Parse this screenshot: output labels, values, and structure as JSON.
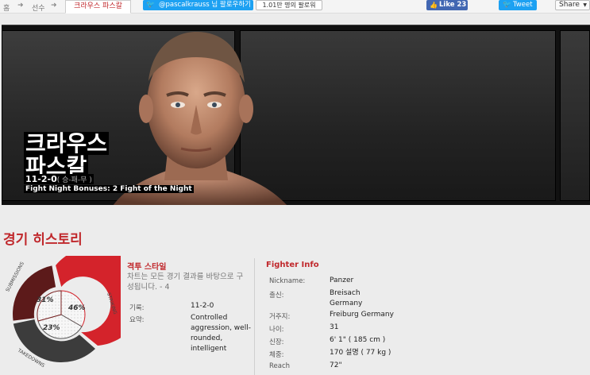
{
  "breadcrumb": {
    "home": "홈",
    "fighters": "선수",
    "current": "크라우스 파스칼"
  },
  "social": {
    "twitter_follow": "@pascalkrauss 님 팔로우하기",
    "follower_count": "1.01만 명의 팔로워",
    "fb_like": "Like",
    "fb_like_count": "23",
    "tweet": "Tweet",
    "share": "Share"
  },
  "hero": {
    "name_line1": "크라우스",
    "name_line2": "파스칼",
    "record": "11-2-0",
    "record_note": "( 승-패-무 )",
    "bonuses": "Fight Night Bonuses: 2 Fight of the Night"
  },
  "history": {
    "title": "경기 히스토리",
    "donut": {
      "labels": [
        "SUBMISSIONS",
        "STRIKING",
        "TAKEDOWNS"
      ],
      "percents": [
        "31%",
        "46%",
        "23%"
      ],
      "values": [
        31,
        46,
        23
      ],
      "colors": {
        "submissions": "#6b1c1c",
        "striking": "#d4232b",
        "takedowns": "#3a3a3a"
      }
    },
    "style": {
      "title": "격투 스타일",
      "description": "차트는 모든 경기 결과를 바탕으로 구성됩니다. - 4",
      "record_label": "기록:",
      "record_value": "11-2-0",
      "summary_label": "요약:",
      "summary_value": "Controlled aggression, well-rounded, intelligent"
    }
  },
  "fighter_info": {
    "title": "Fighter Info",
    "rows": [
      {
        "label": "Nickname:",
        "value": "Panzer"
      },
      {
        "label": "출신:",
        "value": "Breisach Germany"
      },
      {
        "label": "거주지:",
        "value": "Freiburg Germany"
      },
      {
        "label": "나이:",
        "value": "31"
      },
      {
        "label": "신장:",
        "value": "6' 1\" ( 185 cm )"
      },
      {
        "label": "체중:",
        "value": "170 설명 ( 77 kg )"
      },
      {
        "label": "Reach",
        "value": "72\""
      }
    ]
  }
}
